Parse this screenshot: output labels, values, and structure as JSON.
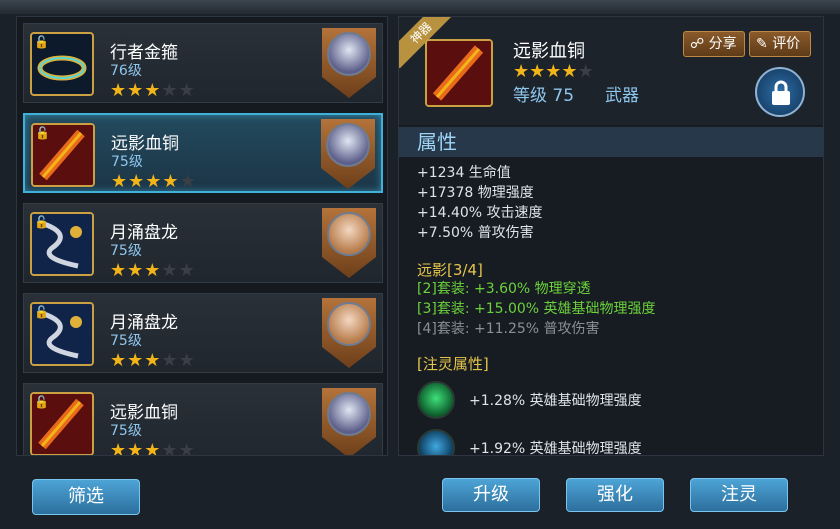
{
  "items": [
    {
      "name": "行者金箍",
      "level": "76级",
      "stars": 3,
      "lock": "🔓"
    },
    {
      "name": "远影血铜",
      "level": "75级",
      "stars": 4,
      "lock": "🔓"
    },
    {
      "name": "月涌盘龙",
      "level": "75级",
      "stars": 3,
      "lock": "🔓"
    },
    {
      "name": "月涌盘龙",
      "level": "75级",
      "stars": 3,
      "lock": "🔓"
    },
    {
      "name": "远影血铜",
      "level": "75级",
      "stars": 3,
      "lock": "🔓"
    }
  ],
  "filter_label": "筛选",
  "detail": {
    "ribbon": "神器",
    "name": "远影血铜",
    "stars": 4,
    "level": "等级 75",
    "type": "武器",
    "share": "分享",
    "rate": "评价",
    "section": "属性",
    "stats": [
      "+1234 生命值",
      "+17378 物理强度",
      "+14.40% 攻击速度",
      "+7.50% 普攻伤害"
    ],
    "set_title": "远影[3/4]",
    "set_lines": [
      "[2]套装: +3.60% 物理穿透",
      "[3]套装: +15.00% 英雄基础物理强度",
      "[4]套装: +11.25% 普攻伤害"
    ],
    "infuse_title": "[注灵属性]",
    "infuse": [
      "+1.28% 英雄基础物理强度",
      "+1.92% 英雄基础物理强度"
    ]
  },
  "actions": {
    "upgrade": "升级",
    "enhance": "强化",
    "infuse": "注灵"
  },
  "colors": {
    "accent": "#3fb0d8",
    "gold": "#f2b418",
    "set_active": "#6cd13a"
  },
  "icons": {
    "lock": "lock-icon",
    "share": "share-icon",
    "rate": "edit-icon"
  }
}
